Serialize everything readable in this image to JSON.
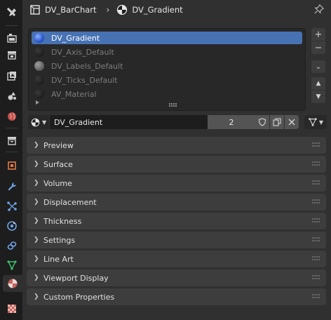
{
  "header": {
    "object_name": "DV_BarChart",
    "material_name": "DV_Gradient"
  },
  "slots": [
    {
      "name": "DV_Gradient",
      "active": true
    },
    {
      "name": "DV_Axis_Default",
      "active": false
    },
    {
      "name": "DV_Labels_Default",
      "active": false
    },
    {
      "name": "DV_Ticks_Default",
      "active": false
    },
    {
      "name": "AV_Material",
      "active": false
    }
  ],
  "side_buttons": {
    "add": "+",
    "remove": "−",
    "menu": "⌄",
    "up": "▲",
    "down": "▼"
  },
  "material": {
    "name": "DV_Gradient",
    "users": "2"
  },
  "panels": [
    "Preview",
    "Surface",
    "Volume",
    "Displacement",
    "Thickness",
    "Settings",
    "Line Art",
    "Viewport Display",
    "Custom Properties"
  ],
  "colors": {
    "accent": "#4772b3",
    "panel": "#3d3d3d",
    "background": "#303030",
    "tabbar": "#1d1d1d"
  }
}
